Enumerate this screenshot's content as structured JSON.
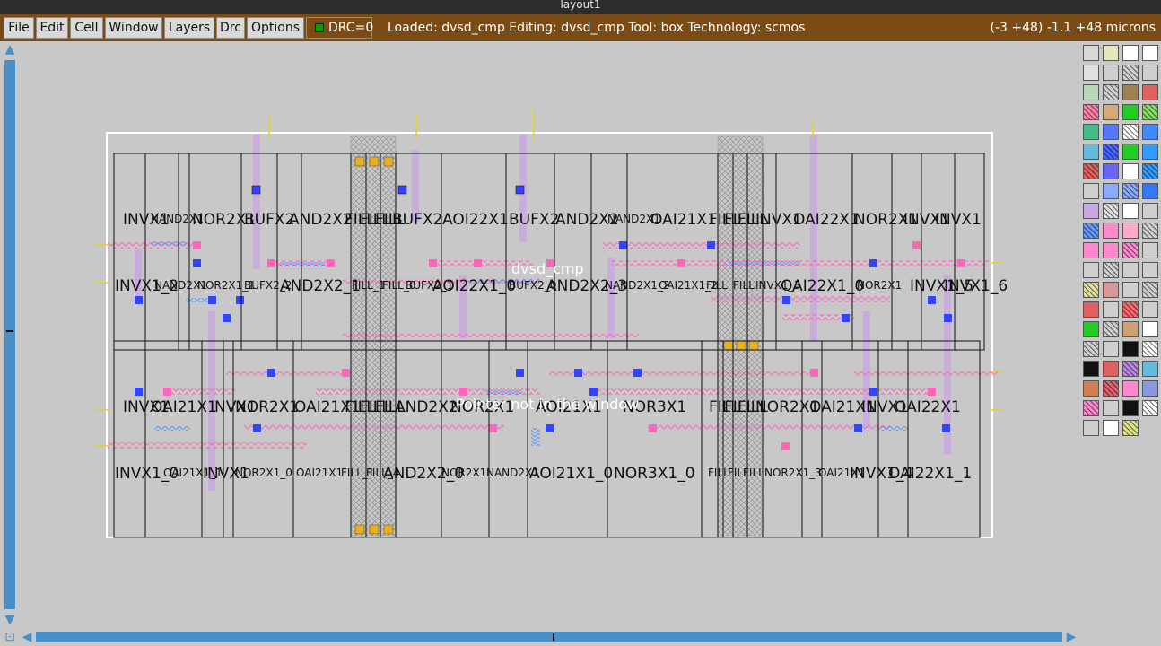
{
  "window": {
    "title": "layout1"
  },
  "menu": [
    "File",
    "Edit",
    "Cell",
    "Window",
    "Layers",
    "Drc",
    "Options"
  ],
  "drc": {
    "label": "DRC=0",
    "status_color": "#00a000"
  },
  "status": {
    "left": "Loaded: dvsd_cmp  Editing: dvsd_cmp  Tool: box   Technology: scmos",
    "right": "(-3 +48) -1.1 +48 microns"
  },
  "layout": {
    "top_cell": "dvsd_cmp",
    "message": "Pointer not in the window",
    "row1_types": [
      "INVX1",
      "NAND2X1",
      "NOR2X1",
      "BUFX2",
      "AND2X2",
      "FILL",
      "FILL",
      "FILL",
      "BUFX2",
      "AOI22X1",
      "BUFX2",
      "AND2X2",
      "NAND2X1",
      "OAI21X1",
      "FILL",
      "FILL",
      "FILL",
      "INVX1",
      "OAI22X1",
      "NOR2X1",
      "INVX1",
      "INVX1"
    ],
    "row1_inst": [
      "INVX1_2",
      "NAND2X1",
      "NOR2X1_1",
      "BUFX2_2",
      "AND2X2_1",
      "FILL_1",
      "FILL_0",
      "BUFX2_1",
      "AOI22X1_0",
      "BUFX2_0",
      "AND2X2_3",
      "NAND2X1_2",
      "OAI21X1_2",
      "FILL",
      "FILL",
      "INVX1_3",
      "OAI22X1_0",
      "NOR2X1",
      "INVX1_5",
      "INVX1_6"
    ],
    "row2_types": [
      "INVX1",
      "OAI21X1",
      "INVX1",
      "NOR2X1",
      "OAI21X1",
      "FILL",
      "FILL",
      "FILL",
      "AND2X2",
      "NOR2X1",
      "AOI21X1",
      "NOR3X1",
      "FILL",
      "FILL",
      "FILL",
      "NOR2X1",
      "OAI21X1",
      "INVX1",
      "OAI22X1"
    ],
    "row2_inst": [
      "INVX1_0",
      "OAI21X1_1",
      "INVX1",
      "NOR2X1_0",
      "OAI21X1",
      "FILL_1",
      "FILL_4",
      "AND2X2_0",
      "NOR2X1",
      "NAND2X1",
      "AOI21X1_0",
      "NOR3X1_0",
      "FILL",
      "FILL",
      "FILL",
      "NOR2X1_3",
      "OAI21X1",
      "INVX1_4",
      "OAI22X1_1"
    ]
  },
  "palette": {
    "icons": [
      "grid-pattern-icon",
      "none-layer-icon",
      "solid-fill-icon",
      "outline-icon"
    ],
    "colors": [
      "#d8d8d8",
      "#e6e6b8",
      "#ffffff",
      "#ffffff",
      "#e0e0e0",
      "#cfcfcf",
      "#cfcfcf",
      "#cfcfcf",
      "#b8d8b8",
      "#cfcfcf",
      "#a08050",
      "#e06060",
      "#ff7faa",
      "#d8a878",
      "#22cc22",
      "#88dd66",
      "#44bb88",
      "#5577ff",
      "#ffffff",
      "#4488ff",
      "#66bbdd",
      "#4466ff",
      "#22cc22",
      "#3399ff",
      "#e06060",
      "#6666ff",
      "#ffffff",
      "#3399ff",
      "#cfcfcf",
      "#88aaff",
      "#88aaff",
      "#3377ff",
      "#c8a8e0",
      "#e0e0e0",
      "#ffffff",
      "#cfcfcf",
      "#6699ff",
      "#ff88cc",
      "#ffaacc",
      "#cfcfcf",
      "#ff88cc",
      "#ff88cc",
      "#ff88cc",
      "#cfcfcf",
      "#cfcfcf",
      "#cfcfcf",
      "#cfcfcf",
      "#cfcfcf",
      "#e0e0a0",
      "#d89898",
      "#cfcfcf",
      "#cfcfcf",
      "#e06060",
      "#cfcfcf",
      "#ff6666",
      "#cfcfcf",
      "#22cc22",
      "#cfcfcf",
      "#d0a070",
      "#ffffff",
      "#cfcfcf",
      "#cfcfcf",
      "#111111",
      "#ffffff",
      "#111111",
      "#e06060",
      "#b888e0",
      "#66bbdd",
      "#d08050",
      "#e06070",
      "#ff88cc",
      "#8899dd",
      "#ff88cc",
      "#cfcfcf",
      "#111111",
      "#ffffff",
      "#cfcfcf",
      "#ffffff",
      "#e0e088"
    ]
  }
}
